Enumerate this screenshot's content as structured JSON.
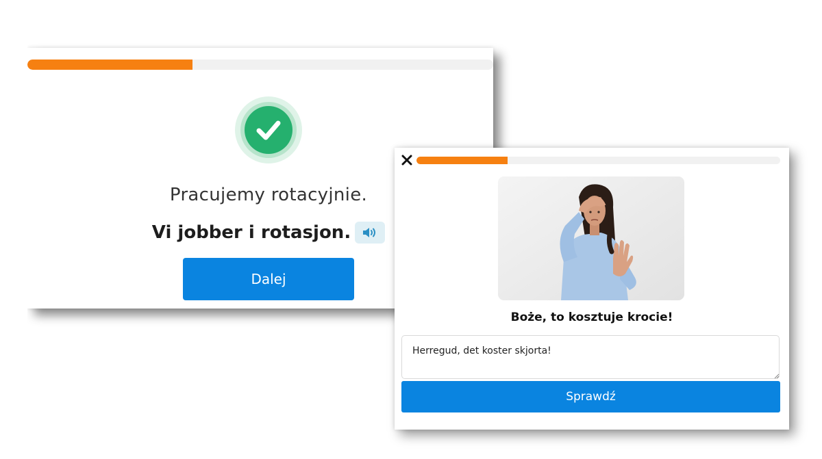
{
  "colors": {
    "accent_orange": "#f68011",
    "primary_blue": "#0a84e0",
    "success_green": "#25b06e",
    "track_gray": "#f1f1f1"
  },
  "feedback_card": {
    "progress": 0.355,
    "status_icon": "check-circle-icon",
    "translation": "Pracujemy rotacyjnie.",
    "answer": "Vi jobber i rotasjon.",
    "audio_icon": "speaker-icon",
    "next_label": "Dalej"
  },
  "exercise_card": {
    "close_icon": "close-icon",
    "progress": 0.25,
    "image_icon": "woman-stop-gesture-photo",
    "prompt": "Boże, to kosztuje krocie!",
    "answer_value": "Herregud, det koster skjorta!",
    "check_label": "Sprawdź"
  }
}
